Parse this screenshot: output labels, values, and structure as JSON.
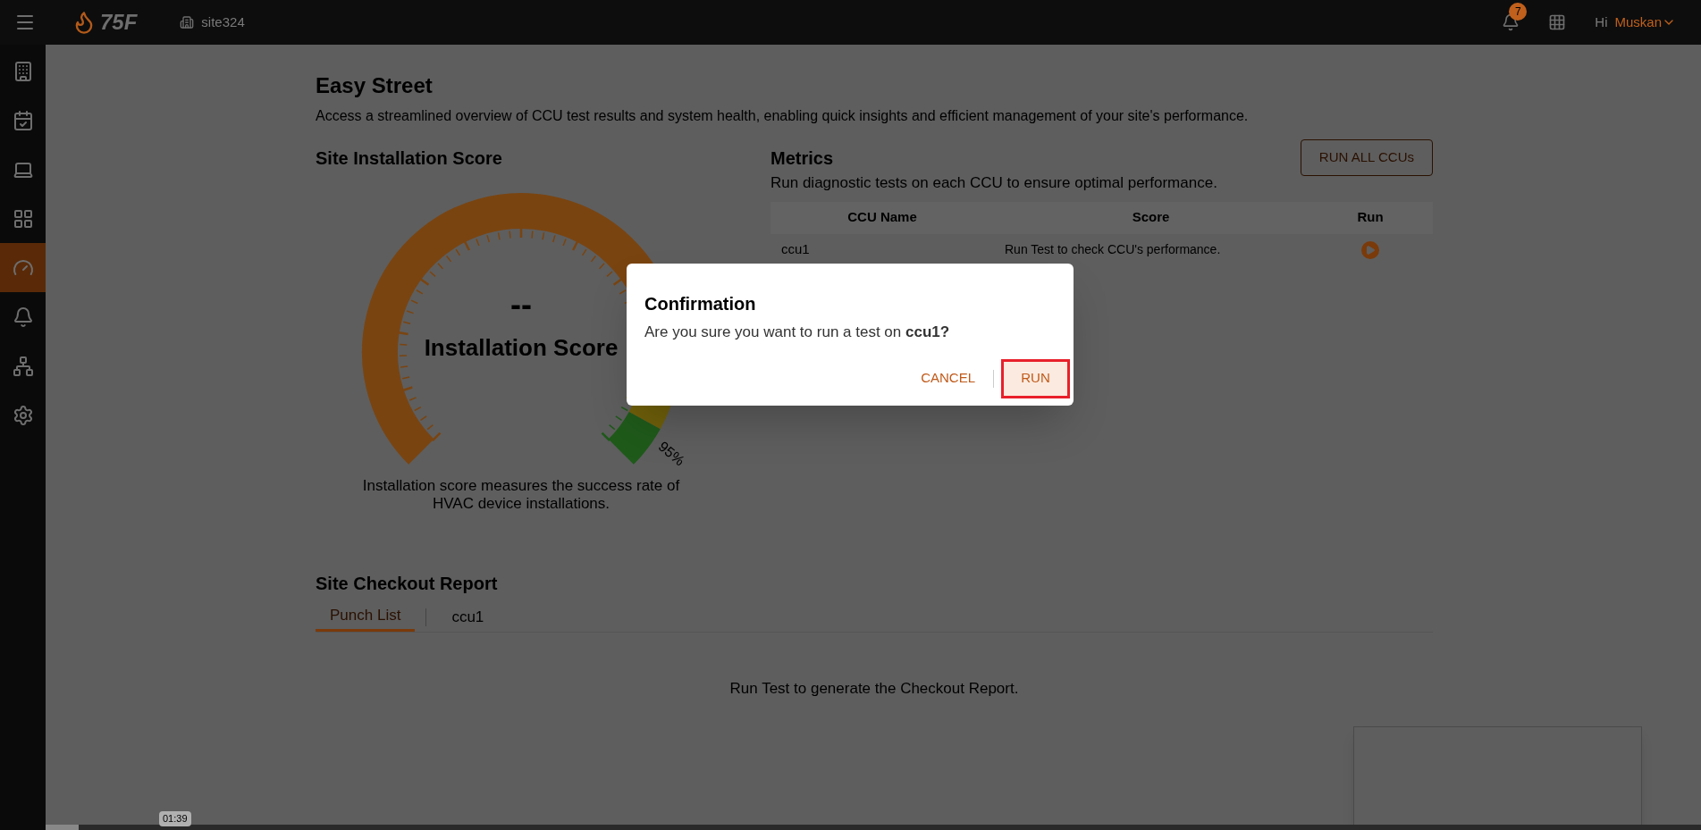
{
  "header": {
    "logo_text": "75F",
    "site": "site324",
    "notification_count": "7",
    "greeting": "Hi",
    "user": "Muskan"
  },
  "sidebar": {
    "items": [
      {
        "kind": "building",
        "selected": false
      },
      {
        "kind": "calendar",
        "selected": false
      },
      {
        "kind": "laptop",
        "selected": false
      },
      {
        "kind": "grid",
        "selected": false
      },
      {
        "kind": "gauge",
        "selected": true
      },
      {
        "kind": "bell",
        "selected": false
      },
      {
        "kind": "network",
        "selected": false
      },
      {
        "kind": "cogs",
        "selected": false
      }
    ]
  },
  "page": {
    "title": "Easy Street",
    "description": "Access a streamlined overview of CCU test results and system health, enabling quick insights and efficient management of your site's performance."
  },
  "installation_score": {
    "title": "Site Installation Score",
    "value": "--",
    "label": "Installation Score",
    "target": "95%",
    "caption": "Installation score measures the success rate of HVAC device installations."
  },
  "metrics": {
    "title": "Metrics",
    "description": "Run diagnostic tests on each CCU to ensure optimal performance.",
    "run_all": "RUN ALL CCUs",
    "columns": [
      "CCU Name",
      "Score",
      "Run"
    ],
    "rows": [
      {
        "name": "ccu1",
        "score": "Run Test to check CCU's performance."
      }
    ]
  },
  "checkout": {
    "title": "Site Checkout Report",
    "tabs": [
      {
        "label": "Punch List",
        "selected": true
      },
      {
        "label": "ccu1",
        "selected": false
      }
    ],
    "empty_message": "Run Test to generate the Checkout Report."
  },
  "dialog": {
    "title": "Confirmation",
    "message": "Are you sure you want to run a test on **ccu1?**",
    "cancel": "CANCEL",
    "confirm": "RUN"
  },
  "video": {
    "time": "01:39",
    "level": 0.02
  }
}
